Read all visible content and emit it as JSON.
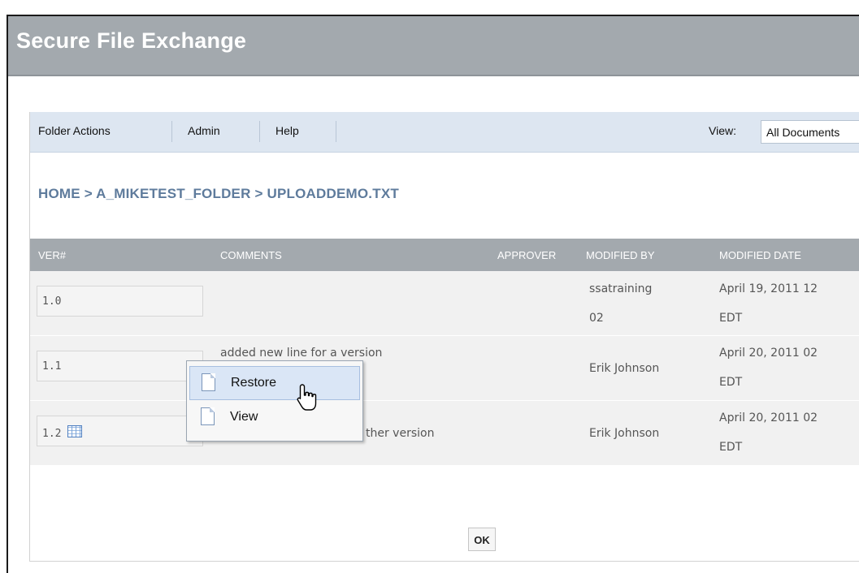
{
  "app": {
    "title": "Secure File Exchange"
  },
  "menubar": {
    "items": [
      {
        "label": "Folder Actions"
      },
      {
        "label": "Admin"
      },
      {
        "label": "Help"
      }
    ],
    "view_label": "View:",
    "view_selected": "All Documents"
  },
  "breadcrumb": "HOME > A_MIKETEST_FOLDER > UPLOADDEMO.TXT",
  "table": {
    "columns": [
      "VER#",
      "COMMENTS",
      "APPROVER",
      "MODIFIED BY",
      "MODIFIED DATE"
    ],
    "rows": [
      {
        "version": "1.0",
        "comment": "",
        "approver": "",
        "modified_by_1": "ssatraining",
        "modified_by_2": "02",
        "date_1": "April 19, 2011 12",
        "date_2": "EDT"
      },
      {
        "version": "1.1",
        "comment": "added new line for a version",
        "approver": "",
        "modified_by_1": "Erik Johnson",
        "modified_by_2": "",
        "date_1": "April 20, 2011 02",
        "date_2": "EDT"
      },
      {
        "version": "1.2",
        "comment": "ther version",
        "approver": "",
        "modified_by_1": "Erik Johnson",
        "modified_by_2": "",
        "date_1": "April 20, 2011 02",
        "date_2": "EDT"
      }
    ]
  },
  "ok_label": "OK",
  "context_menu": {
    "items": [
      {
        "label": "Restore",
        "icon": "document-icon"
      },
      {
        "label": "View",
        "icon": "document-icon"
      }
    ]
  },
  "colors": {
    "title_bar": "#a3a9ae",
    "menu_bar": "#dde6f1",
    "breadcrumb": "#5e7b9c",
    "row_bg": "#f1f1f1",
    "menu_highlight": "#dae6f6"
  }
}
